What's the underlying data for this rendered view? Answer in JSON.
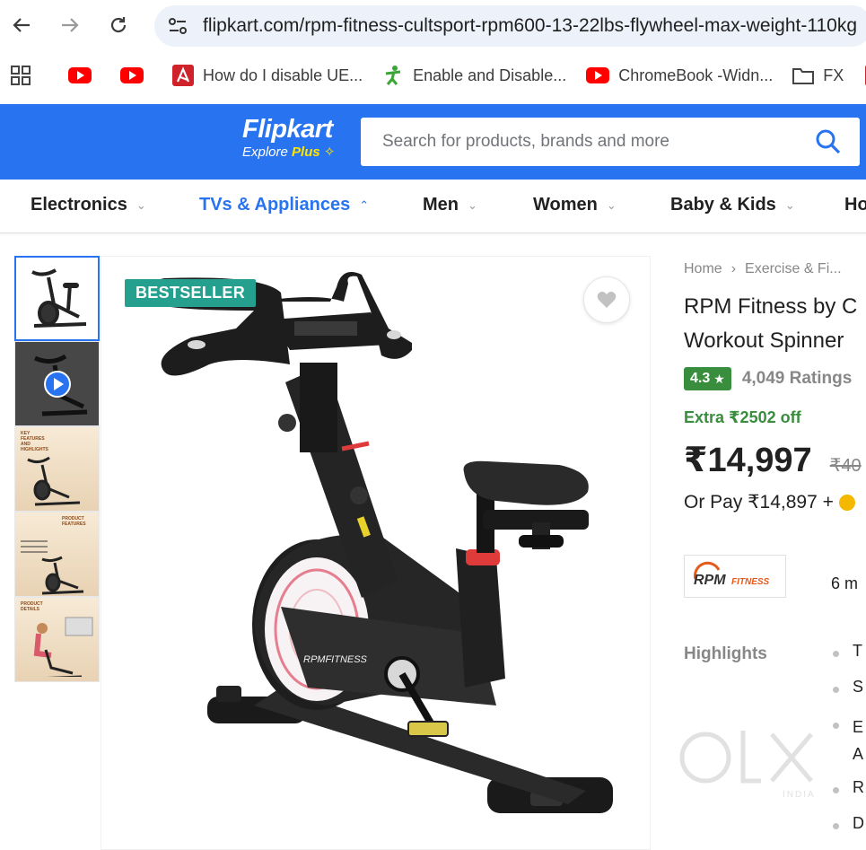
{
  "browser": {
    "url": "flipkart.com/rpm-fitness-cultsport-rpm600-13-22lbs-flywheel-max-weight-110kg",
    "bookmarks": [
      {
        "icon": "youtube-icon",
        "label": ""
      },
      {
        "icon": "youtube-icon",
        "label": ""
      },
      {
        "icon": "avira-icon",
        "label": "How do I disable UE..."
      },
      {
        "icon": "person-star-icon",
        "label": "Enable and Disable..."
      },
      {
        "icon": "youtube-icon",
        "label": "ChromeBook -Widn..."
      },
      {
        "icon": "folder-icon",
        "label": "FX"
      }
    ]
  },
  "header": {
    "brand": "Flipkart",
    "tagline_prefix": "Explore ",
    "tagline_plus": "Plus",
    "search_placeholder": "Search for products, brands and more"
  },
  "categories": [
    {
      "label": "Electronics",
      "active": false
    },
    {
      "label": "TVs & Appliances",
      "active": true
    },
    {
      "label": "Men",
      "active": false
    },
    {
      "label": "Women",
      "active": false
    },
    {
      "label": "Baby & Kids",
      "active": false
    },
    {
      "label": "Ho",
      "active": false
    }
  ],
  "product": {
    "badge": "BESTSELLER",
    "breadcrumb": [
      "Home",
      "Exercise & Fi..."
    ],
    "title_line1": "RPM Fitness by C",
    "title_line2": "Workout Spinner",
    "rating": "4.3",
    "ratings_count": "4,049 Ratings",
    "extra_off": "Extra ₹2502 off",
    "price": "₹14,997",
    "mrp": "₹40",
    "or_pay": "Or Pay ₹14,897 +",
    "brand_logo_text": "RPM",
    "brand_logo_sub": "FITNESS",
    "bike_logo_text": "RPMFITNESS",
    "warranty": "6 m",
    "highlights_label": "Highlights",
    "highlights": [
      "T",
      "S",
      "E\nA",
      "R",
      "D"
    ]
  },
  "thumbnails": {
    "third_caption": "KEY FEATURES AND HIGHLIGHTS",
    "fourth_caption": "PRODUCT FEATURES",
    "fifth_caption": "PRODUCT DETAILS"
  },
  "watermark": {
    "text": "olx",
    "sub": "INDIA"
  },
  "colors": {
    "flipkart_blue": "#2874f0",
    "badge_teal": "#26a08e",
    "rating_green": "#388e3c",
    "plus_yellow": "#ffe500"
  }
}
